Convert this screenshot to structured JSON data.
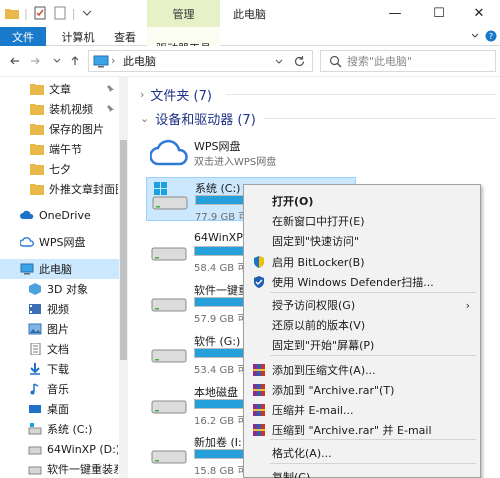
{
  "window": {
    "context_tab": "管理",
    "title": "此电脑",
    "minimize": "—",
    "maximize": "☐",
    "close": "✕"
  },
  "ribbon": {
    "tabs": [
      "文件",
      "计算机",
      "查看",
      "驱动器工具"
    ]
  },
  "address": {
    "path": "此电脑",
    "search_placeholder": "搜索\"此电脑\""
  },
  "sidebar": {
    "items": [
      {
        "label": "文章",
        "icon": "folder-icon"
      },
      {
        "label": "装机视频",
        "icon": "folder-icon"
      },
      {
        "label": "保存的图片",
        "icon": "folder-icon"
      },
      {
        "label": "端午节",
        "icon": "folder-icon"
      },
      {
        "label": "七夕",
        "icon": "folder-icon"
      },
      {
        "label": "外推文章封面图",
        "icon": "folder-icon"
      },
      {
        "label": "OneDrive",
        "icon": "cloud-icon"
      },
      {
        "label": "WPS网盘",
        "icon": "cloud-icon"
      },
      {
        "label": "此电脑",
        "icon": "computer-icon"
      },
      {
        "label": "3D 对象",
        "icon": "cube-icon"
      },
      {
        "label": "视频",
        "icon": "video-icon"
      },
      {
        "label": "图片",
        "icon": "pictures-icon"
      },
      {
        "label": "文档",
        "icon": "documents-icon"
      },
      {
        "label": "下载",
        "icon": "download-icon"
      },
      {
        "label": "音乐",
        "icon": "music-icon"
      },
      {
        "label": "桌面",
        "icon": "desktop-icon"
      },
      {
        "label": "系统 (C:)",
        "icon": "drive-icon"
      },
      {
        "label": "64WinXP (D:)",
        "icon": "drive-icon"
      },
      {
        "label": "软件一键重装系统",
        "icon": "drive-icon"
      }
    ]
  },
  "main": {
    "groups": {
      "folders": "文件夹 (7)",
      "devices": "设备和驱动器 (7)"
    },
    "wps": {
      "name": "WPS网盘",
      "desc": "双击进入WPS网盘"
    },
    "drives": [
      {
        "name": "系统 (C:)",
        "free": "77.9 GB 可",
        "usage": 0.38
      },
      {
        "name": "64WinXP",
        "free": "58.4 GB 可",
        "usage": 0.42
      },
      {
        "name": "软件一键重",
        "free": "57.9 GB 可",
        "usage": 0.43
      },
      {
        "name": "软件 (G:)",
        "free": "53.4 GB 可",
        "usage": 0.47
      },
      {
        "name": "本地磁盘",
        "free": "16.2 GB 可",
        "usage": 0.6
      },
      {
        "name": "新加卷 (I:)",
        "free": "15.8 GB 可",
        "usage": 0.62
      }
    ]
  },
  "context_menu": {
    "items": [
      {
        "label": "打开(O)",
        "bold": true
      },
      {
        "label": "在新窗口中打开(E)"
      },
      {
        "label": "固定到\"快速访问\""
      },
      {
        "label": "启用 BitLocker(B)",
        "icon": "shield-icon"
      },
      {
        "label": "使用 Windows Defender扫描...",
        "icon": "defender-icon"
      },
      {
        "label": "授予访问权限(G)",
        "submenu": "›"
      },
      {
        "label": "还原以前的版本(V)"
      },
      {
        "label": "固定到\"开始\"屏幕(P)"
      },
      {
        "label": "添加到压缩文件(A)...",
        "icon": "winrar-icon"
      },
      {
        "label": "添加到 \"Archive.rar\"(T)",
        "icon": "winrar-icon"
      },
      {
        "label": "压缩并 E-mail...",
        "icon": "winrar-icon"
      },
      {
        "label": "压缩到 \"Archive.rar\" 并 E-mail",
        "icon": "winrar-icon"
      },
      {
        "label": "格式化(A)..."
      },
      {
        "label": "复制(C)"
      }
    ]
  }
}
